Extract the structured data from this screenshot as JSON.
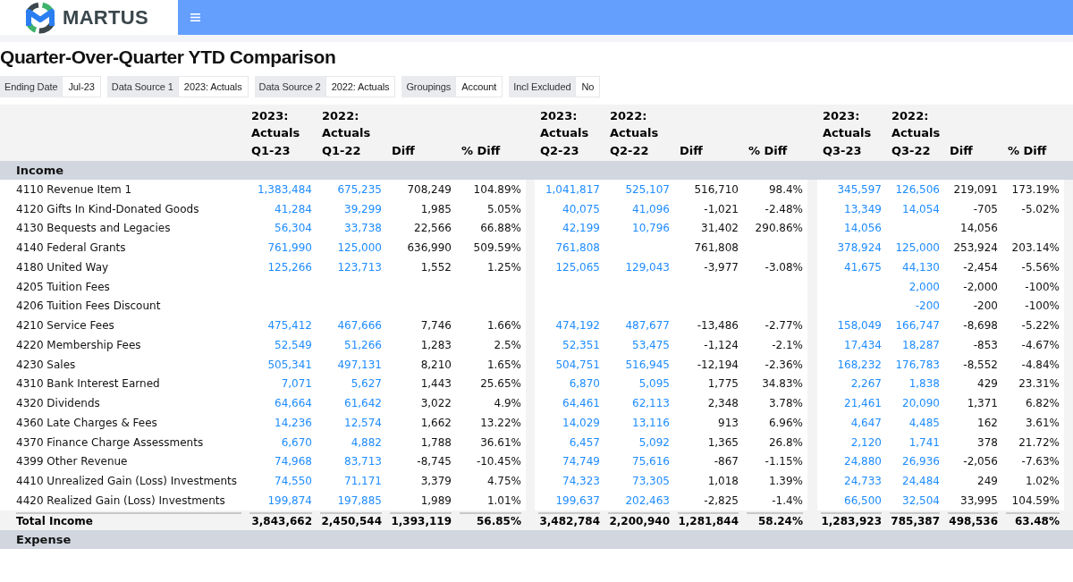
{
  "header": {
    "logo_text": "MARTUS"
  },
  "title": "Quarter-Over-Quarter YTD Comparison",
  "filters": [
    {
      "label": "Ending Date",
      "value": "Jul-23"
    },
    {
      "label": "Data Source 1",
      "value": "2023: Actuals"
    },
    {
      "label": "Data Source 2",
      "value": "2022: Actuals"
    },
    {
      "label": "Groupings",
      "value": "Account"
    },
    {
      "label": "Incl Excluded",
      "value": "No"
    }
  ],
  "table": {
    "groups": [
      {
        "columns": [
          {
            "label": "2023: Actuals Q1-23",
            "kind": "actual"
          },
          {
            "label": "2022: Actuals Q1-22",
            "kind": "actual"
          },
          {
            "label": "Diff",
            "kind": "diff"
          },
          {
            "label": "% Diff",
            "kind": "percent"
          }
        ]
      },
      {
        "columns": [
          {
            "label": "2023: Actuals Q2-23",
            "kind": "actual"
          },
          {
            "label": "2022: Actuals Q2-22",
            "kind": "actual"
          },
          {
            "label": "Diff",
            "kind": "diff"
          },
          {
            "label": "% Diff",
            "kind": "percent"
          }
        ]
      },
      {
        "columns": [
          {
            "label": "2023: Actuals Q3-23",
            "kind": "actual"
          },
          {
            "label": "2022: Actuals Q3-22",
            "kind": "actual"
          },
          {
            "label": "Diff",
            "kind": "diff"
          },
          {
            "label": "% Diff",
            "kind": "percent"
          }
        ]
      }
    ],
    "sections": [
      {
        "title": "Income",
        "rows": [
          {
            "account": "4110 Revenue Item 1",
            "cells": [
              [
                "1,383,484",
                "675,235",
                "708,249",
                "104.89%"
              ],
              [
                "1,041,817",
                "525,107",
                "516,710",
                "98.4%"
              ],
              [
                "345,597",
                "126,506",
                "219,091",
                "173.19%"
              ]
            ]
          },
          {
            "account": "4120 Gifts In Kind-Donated Goods",
            "cells": [
              [
                "41,284",
                "39,299",
                "1,985",
                "5.05%"
              ],
              [
                "40,075",
                "41,096",
                "-1,021",
                "-2.48%"
              ],
              [
                "13,349",
                "14,054",
                "-705",
                "-5.02%"
              ]
            ]
          },
          {
            "account": "4130 Bequests and Legacies",
            "cells": [
              [
                "56,304",
                "33,738",
                "22,566",
                "66.88%"
              ],
              [
                "42,199",
                "10,796",
                "31,402",
                "290.86%"
              ],
              [
                "14,056",
                null,
                "14,056",
                null
              ]
            ]
          },
          {
            "account": "4140 Federal Grants",
            "cells": [
              [
                "761,990",
                "125,000",
                "636,990",
                "509.59%"
              ],
              [
                "761,808",
                null,
                "761,808",
                null
              ],
              [
                "378,924",
                "125,000",
                "253,924",
                "203.14%"
              ]
            ]
          },
          {
            "account": "4180 United Way",
            "cells": [
              [
                "125,266",
                "123,713",
                "1,552",
                "1.25%"
              ],
              [
                "125,065",
                "129,043",
                "-3,977",
                "-3.08%"
              ],
              [
                "41,675",
                "44,130",
                "-2,454",
                "-5.56%"
              ]
            ]
          },
          {
            "account": "4205 Tuition Fees",
            "cells": [
              [
                null,
                null,
                null,
                null
              ],
              [
                null,
                null,
                null,
                null
              ],
              [
                null,
                "2,000",
                "-2,000",
                "-100%"
              ]
            ]
          },
          {
            "account": "4206 Tuition Fees Discount",
            "cells": [
              [
                null,
                null,
                null,
                null
              ],
              [
                null,
                null,
                null,
                null
              ],
              [
                null,
                "-200",
                "-200",
                "-100%"
              ]
            ]
          },
          {
            "account": "4210 Service Fees",
            "cells": [
              [
                "475,412",
                "467,666",
                "7,746",
                "1.66%"
              ],
              [
                "474,192",
                "487,677",
                "-13,486",
                "-2.77%"
              ],
              [
                "158,049",
                "166,747",
                "-8,698",
                "-5.22%"
              ]
            ]
          },
          {
            "account": "4220 Membership Fees",
            "cells": [
              [
                "52,549",
                "51,266",
                "1,283",
                "2.5%"
              ],
              [
                "52,351",
                "53,475",
                "-1,124",
                "-2.1%"
              ],
              [
                "17,434",
                "18,287",
                "-853",
                "-4.67%"
              ]
            ]
          },
          {
            "account": "4230 Sales",
            "cells": [
              [
                "505,341",
                "497,131",
                "8,210",
                "1.65%"
              ],
              [
                "504,751",
                "516,945",
                "-12,194",
                "-2.36%"
              ],
              [
                "168,232",
                "176,783",
                "-8,552",
                "-4.84%"
              ]
            ]
          },
          {
            "account": "4310 Bank Interest Earned",
            "cells": [
              [
                "7,071",
                "5,627",
                "1,443",
                "25.65%"
              ],
              [
                "6,870",
                "5,095",
                "1,775",
                "34.83%"
              ],
              [
                "2,267",
                "1,838",
                "429",
                "23.31%"
              ]
            ]
          },
          {
            "account": "4320 Dividends",
            "cells": [
              [
                "64,664",
                "61,642",
                "3,022",
                "4.9%"
              ],
              [
                "64,461",
                "62,113",
                "2,348",
                "3.78%"
              ],
              [
                "21,461",
                "20,090",
                "1,371",
                "6.82%"
              ]
            ]
          },
          {
            "account": "4360 Late Charges & Fees",
            "cells": [
              [
                "14,236",
                "12,574",
                "1,662",
                "13.22%"
              ],
              [
                "14,029",
                "13,116",
                "913",
                "6.96%"
              ],
              [
                "4,647",
                "4,485",
                "162",
                "3.61%"
              ]
            ]
          },
          {
            "account": "4370 Finance Charge Assessments",
            "cells": [
              [
                "6,670",
                "4,882",
                "1,788",
                "36.61%"
              ],
              [
                "6,457",
                "5,092",
                "1,365",
                "26.8%"
              ],
              [
                "2,120",
                "1,741",
                "378",
                "21.72%"
              ]
            ]
          },
          {
            "account": "4399 Other Revenue",
            "cells": [
              [
                "74,968",
                "83,713",
                "-8,745",
                "-10.45%"
              ],
              [
                "74,749",
                "75,616",
                "-867",
                "-1.15%"
              ],
              [
                "24,880",
                "26,936",
                "-2,056",
                "-7.63%"
              ]
            ]
          },
          {
            "account": "4410 Unrealized Gain (Loss) Investments",
            "cells": [
              [
                "74,550",
                "71,171",
                "3,379",
                "4.75%"
              ],
              [
                "74,323",
                "73,305",
                "1,018",
                "1.39%"
              ],
              [
                "24,733",
                "24,484",
                "249",
                "1.02%"
              ]
            ]
          },
          {
            "account": "4420 Realized Gain (Loss) Investments",
            "cells": [
              [
                "199,874",
                "197,885",
                "1,989",
                "1.01%"
              ],
              [
                "199,637",
                "202,463",
                "-2,825",
                "-1.4%"
              ],
              [
                "66,500",
                "32,504",
                "33,995",
                "104.59%"
              ]
            ]
          }
        ],
        "total": {
          "label": "Total Income",
          "cells": [
            [
              "3,843,662",
              "2,450,544",
              "1,393,119",
              "56.85%"
            ],
            [
              "3,482,784",
              "2,200,940",
              "1,281,844",
              "58.24%"
            ],
            [
              "1,283,923",
              "785,387",
              "498,536",
              "63.48%"
            ]
          ]
        }
      },
      {
        "title": "Expense"
      }
    ]
  }
}
